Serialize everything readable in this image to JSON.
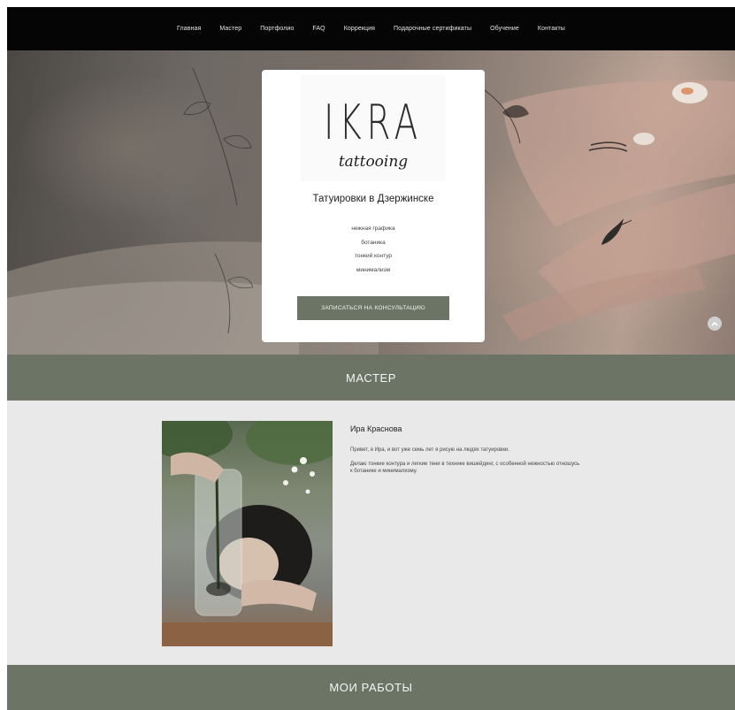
{
  "nav": {
    "items": [
      "Главная",
      "Мастер",
      "Портфолио",
      "FAQ",
      "Коррекция",
      "Подарочные сертификаты",
      "Обучение",
      "Контакты"
    ]
  },
  "hero": {
    "logo_main": "IKRA",
    "logo_script": "tattooing",
    "title": "Татуировки в Дзержинске",
    "tags": [
      "нежная графика",
      "ботаника",
      "тонкий контур",
      "минимализм"
    ],
    "cta_label": "ЗАПИСАТЬСЯ НА КОНСУЛЬТАЦИЮ"
  },
  "sections": {
    "master_title": "МАСТЕР",
    "works_title": "МОИ РАБОТЫ"
  },
  "master": {
    "name": "Ира Краснова",
    "text_1": "Привет, я Ира, и вот уже семь лет я рисую на людях татуировки.",
    "text_2": "Делаю тонкие контура и легкие тени в технике вишейдинг, с особенной нежностью отношусь к ботанике и минимализму."
  },
  "colors": {
    "nav_bg": "#050505",
    "accent_green": "#6c7565",
    "page_bg": "#e9e9e9"
  }
}
